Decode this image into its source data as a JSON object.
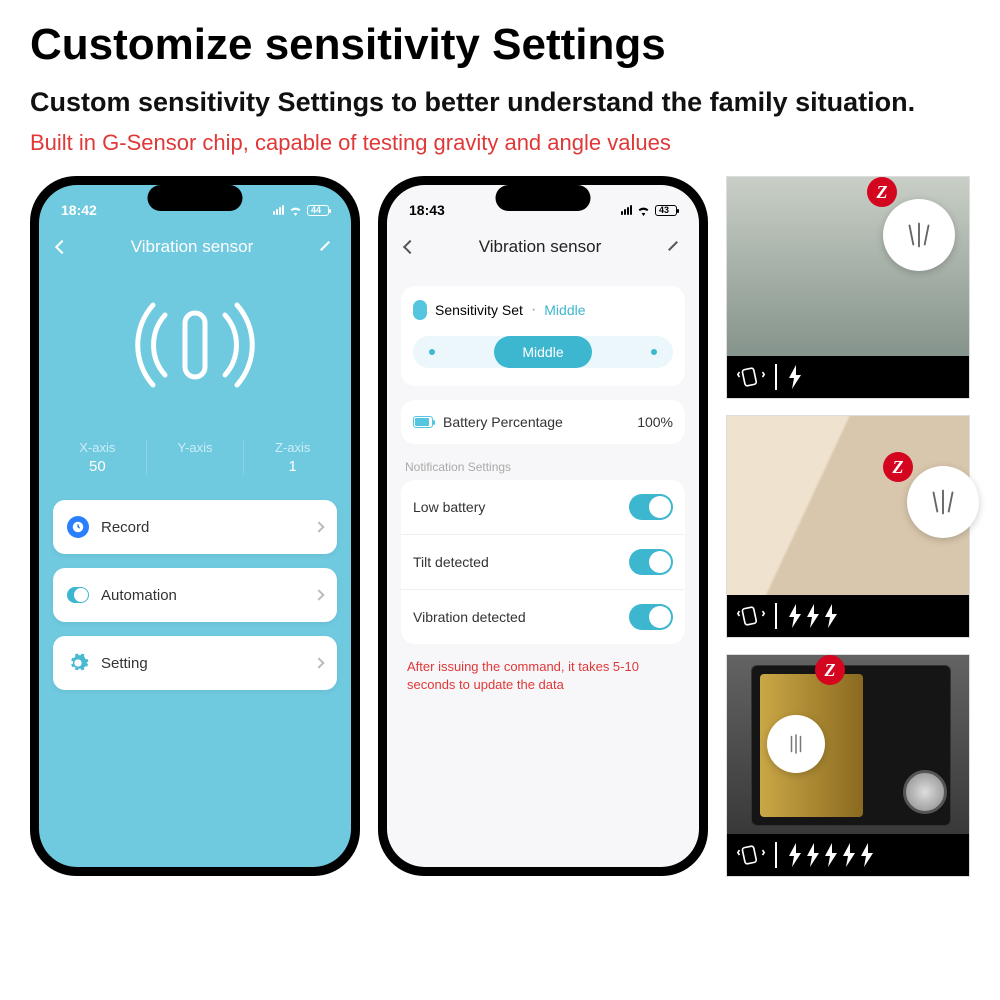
{
  "heading": "Customize sensitivity Settings",
  "subheading": "Custom sensitivity Settings to better understand the family situation.",
  "red_line": "Built in G-Sensor chip, capable of testing gravity and angle values",
  "phone1": {
    "time": "18:42",
    "battery_badge": "44",
    "title": "Vibration sensor",
    "axes": {
      "x_label": "X-axis",
      "x_val": "50",
      "y_label": "Y-axis",
      "y_val": "",
      "z_label": "Z-axis",
      "z_val": "1"
    },
    "rows": {
      "record": "Record",
      "automation": "Automation",
      "setting": "Setting"
    }
  },
  "phone2": {
    "time": "18:43",
    "battery_badge": "43",
    "title": "Vibration sensor",
    "sensitivity_label": "Sensitivity Set",
    "sensitivity_value": "Middle",
    "slider_value": "Middle",
    "battery_label": "Battery Percentage",
    "battery_value": "100%",
    "section": "Notification Settings",
    "notifs": {
      "low": "Low battery",
      "tilt": "Tilt detected",
      "vib": "Vibration detected"
    },
    "note": "After issuing the command, it takes 5-10 seconds to update the data"
  },
  "z_badge": "Z"
}
